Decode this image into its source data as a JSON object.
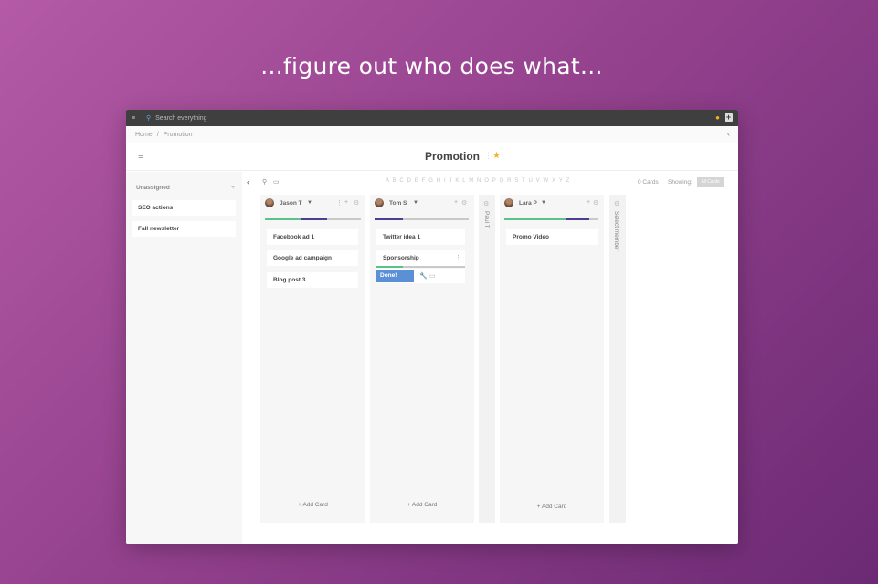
{
  "headline": "...figure out who does what...",
  "topbar": {
    "search_placeholder": "Search everything",
    "menu_icon": "≡",
    "search_icon": "⚲",
    "bell_icon": "🔔",
    "plus_icon": "+"
  },
  "breadcrumb": {
    "home": "Home",
    "separator": "/",
    "current": "Promotion",
    "back_icon": "‹"
  },
  "board": {
    "title": "Promotion",
    "menu_icon": "≡",
    "star_icon": "★",
    "dots_icon": "⋮"
  },
  "sidebar": {
    "unassigned_label": "Unassigned",
    "add_icon": "+",
    "cards": [
      "SEO actions",
      "Fall newsletter"
    ]
  },
  "toolbar": {
    "collapse_icon": "‹",
    "search_icon": "⚲",
    "calendar_icon": "▭",
    "alphabet": "A B C D E F G H I J K L M N O P Q R S T U V W X Y Z",
    "cards_count": "0 Cards",
    "showing_label": "Showing:",
    "filter_value": "All Cards"
  },
  "columns": [
    {
      "member": "Jason T",
      "cards": [
        "Facebook ad 1",
        "Google ad campaign",
        "Blog post 3"
      ],
      "add_label": "+ Add Card",
      "progress": {
        "green": 0.38,
        "blue": 0.27
      }
    },
    {
      "member": "Tom S",
      "cards": [
        "Twitter idea 1",
        "Sponsorship"
      ],
      "add_label": "+ Add Card",
      "done_label": "Done!",
      "progress": {
        "green": 0.0,
        "blue": 0.3
      }
    },
    {
      "member": "Lara P",
      "cards": [
        "Promo Video"
      ],
      "add_label": "+ Add Card",
      "progress": {
        "green": 0.65,
        "blue": 0.25
      }
    }
  ],
  "collapsed_columns": [
    {
      "label": "Paul T"
    },
    {
      "label": "Select member"
    }
  ],
  "colors": {
    "accent_blue": "#5b8fd6",
    "progress_green": "#5cc28b",
    "progress_blue": "#4c3f91",
    "star": "#f2b31c"
  }
}
